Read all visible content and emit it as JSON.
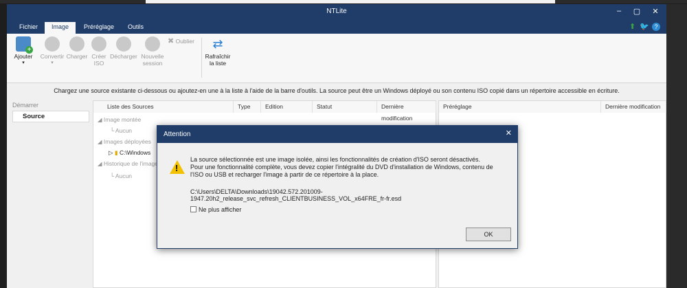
{
  "window": {
    "title": "NTLite",
    "min": "–",
    "max": "▢",
    "close": "✕"
  },
  "menu": {
    "tabs": [
      "Fichier",
      "Image",
      "Préréglage",
      "Outils"
    ],
    "right_icons": [
      "update-arrow-icon",
      "twitter-icon",
      "help-icon"
    ]
  },
  "ribbon": {
    "ajouter": "Ajouter",
    "convertir": "Convertir",
    "charger": "Charger",
    "creer_iso": "Créer ISO",
    "decharger": "Décharger",
    "nouvelle_session": "Nouvelle session",
    "oublier": "Oublier",
    "rafraichir": "Rafraîchir la liste"
  },
  "info_text": "Chargez une source existante ci-dessous ou ajoutez-en une à la liste à l'aide de la barre d'outils. La source peut être un Windows déployé ou son contenu ISO copié dans un répertoire accessible en écriture.",
  "left": {
    "header": "Démarrer",
    "source": "Source"
  },
  "table": {
    "columns": [
      "Liste des Sources",
      "Type",
      "Edition",
      "Statut",
      "Dernière modification"
    ],
    "tree": {
      "image_montee": "Image montée",
      "aucun1": "Aucun",
      "images_deployees": "Images déployées",
      "windows_item": "C:\\Windows",
      "historique": "Historique de l'image",
      "aucun2": "Aucun"
    }
  },
  "right": {
    "columns": [
      "Préréglage",
      "Dernière modification"
    ]
  },
  "dialog": {
    "title": "Attention",
    "close": "✕",
    "line1": "La source sélectionnée est une image isolée, ainsi les fonctionnalités de création d'ISO seront désactivés.",
    "line2": "Pour une fonctionnalité complète, vous devez copier l'intégralité du DVD d'installation de Windows, contenu de",
    "line3": "l'ISO ou USB et recharger l'image à partir de ce répertoire à la place.",
    "path": "C:\\Users\\DELTA\\Downloads\\19042.572.201009-1947.20h2_release_svc_refresh_CLIENTBUSINESS_VOL_x64FRE_fr-fr.esd",
    "checkbox": "Ne plus afficher",
    "ok": "OK"
  },
  "colors": {
    "titlebar": "#1f3d68",
    "warning": "#f2c200",
    "accent_green": "#3aa645",
    "accent_blue": "#4a8ac8"
  }
}
